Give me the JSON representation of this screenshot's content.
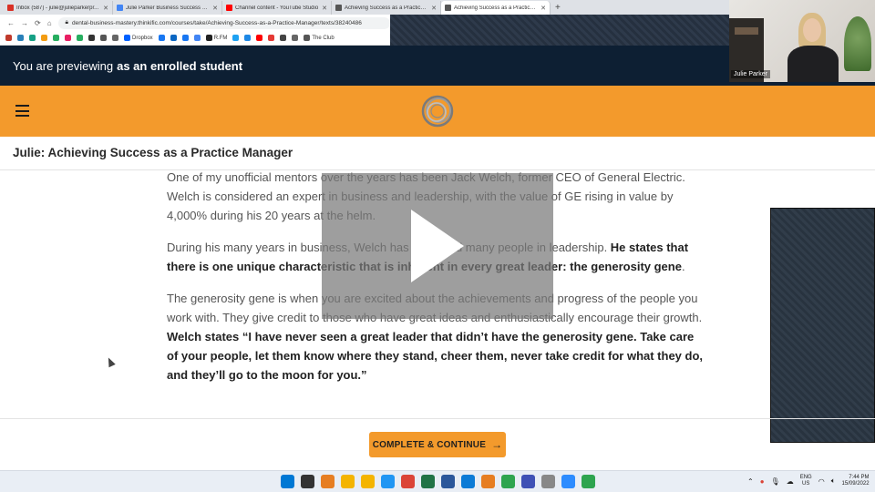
{
  "browser": {
    "tabs": [
      {
        "title": "Inbox (587) - julie@julieparkerpr...",
        "color": "#d93025",
        "active": false
      },
      {
        "title": "Julie Parker Business Success – D...",
        "color": "#4285f4",
        "active": false
      },
      {
        "title": "Channel content - YouTube Studio",
        "color": "#ff0000",
        "active": false
      },
      {
        "title": "Achieving Success as a Practice M...",
        "color": "#555555",
        "active": false
      },
      {
        "title": "Achieving Success as a Practice M...",
        "color": "#555555",
        "active": true
      }
    ],
    "url": "dental-business-mastery.thinkific.com/courses/take/Achieving-Success-as-a-Practice-Manager/texts/38240486",
    "bookmarks": [
      {
        "label": "",
        "color": "#c0392b"
      },
      {
        "label": "",
        "color": "#2980b9"
      },
      {
        "label": "",
        "color": "#16a085"
      },
      {
        "label": "",
        "color": "#f39c12"
      },
      {
        "label": "",
        "color": "#27ae60"
      },
      {
        "label": "",
        "color": "#e91e63"
      },
      {
        "label": "",
        "color": "#27ae60"
      },
      {
        "label": "",
        "color": "#333333"
      },
      {
        "label": "",
        "color": "#555555"
      },
      {
        "label": "",
        "color": "#666666"
      },
      {
        "label": "Dropbox",
        "color": "#0061ff"
      },
      {
        "label": "",
        "color": "#1877f2"
      },
      {
        "label": "",
        "color": "#0a66c2"
      },
      {
        "label": "",
        "color": "#1877f2"
      },
      {
        "label": "",
        "color": "#4285f4"
      },
      {
        "label": "R.FM",
        "color": "#222222"
      },
      {
        "label": "",
        "color": "#1da1f2"
      },
      {
        "label": "",
        "color": "#1e88e5"
      },
      {
        "label": "",
        "color": "#ff0000"
      },
      {
        "label": "",
        "color": "#e53935"
      },
      {
        "label": "",
        "color": "#444444"
      },
      {
        "label": "",
        "color": "#666666"
      },
      {
        "label": "The Club",
        "color": "#555555"
      }
    ]
  },
  "webcam": {
    "name": "Julie Parker"
  },
  "preview": {
    "prefix": "You are previewing",
    "bold": "as an enrolled student"
  },
  "lesson": {
    "title": "Julie: Achieving Success as a Practice Manager",
    "p1": "One of my unofficial mentors over the years has been Jack Welch, former CEO of General Electric. Welch is considered an expert in business and leadership, with the value of GE rising in value by 4,000% during his 20 years at the helm.",
    "p2_plain": "During his many years in business, Welch has promoted many people in leadership. ",
    "p2_bold": "He states that there is one unique characteristic that is inherent in every great leader: the generosity gene",
    "p2_end": ".",
    "p3_plain": "The generosity gene is when you are excited about the achievements and progress of the people you work with. They give credit to those who have great ideas and enthusiastically encourage their growth. ",
    "p3_bold": "Welch states “I have never seen a great leader that didn’t have the generosity gene. Take care of your people, let them know where they stand, cheer them, never take credit for what they do, and they’ll go to the moon for you.”",
    "complete_label": "COMPLETE & CONTINUE",
    "complete_arrow": "→"
  },
  "taskbar": {
    "icons": [
      {
        "name": "windows-start-icon",
        "color": "#0078d4"
      },
      {
        "name": "search-icon",
        "color": "#333333"
      },
      {
        "name": "magnifier-app-icon",
        "color": "#e67e22"
      },
      {
        "name": "file-explorer-icon",
        "color": "#f4b400"
      },
      {
        "name": "file-explorer-folder-icon",
        "color": "#f4b400"
      },
      {
        "name": "notepad-icon",
        "color": "#2196f3"
      },
      {
        "name": "chrome-icon",
        "color": "#db4437"
      },
      {
        "name": "excel-icon",
        "color": "#217346"
      },
      {
        "name": "word-icon",
        "color": "#2b579a"
      },
      {
        "name": "edge-icon",
        "color": "#0c7bd6"
      },
      {
        "name": "calculator-icon",
        "color": "#e67e22"
      },
      {
        "name": "camtasia-icon",
        "color": "#2ea44f"
      },
      {
        "name": "paint-icon",
        "color": "#3f51b5"
      },
      {
        "name": "snipping-tool-icon",
        "color": "#888888"
      },
      {
        "name": "zoom-icon",
        "color": "#2d8cff"
      },
      {
        "name": "camtasia-recorder-icon",
        "color": "#2ea44f"
      }
    ],
    "lang_top": "ENG",
    "lang_bottom": "US",
    "time": "7:44 PM",
    "date": "15/09/2022"
  },
  "colors": {
    "accent": "#f39a2c",
    "navy": "#0d1f33"
  }
}
